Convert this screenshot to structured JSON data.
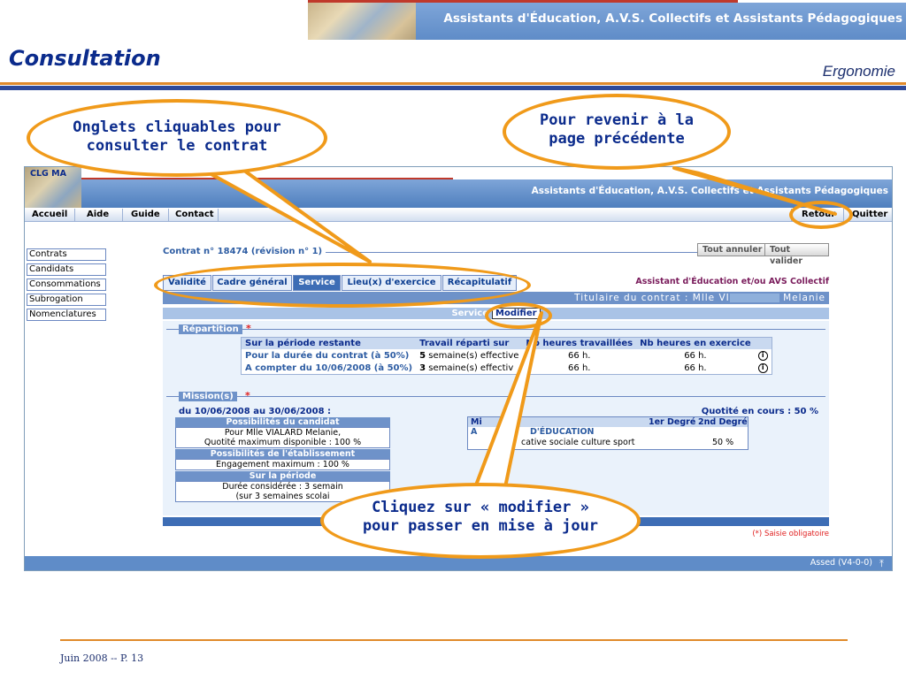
{
  "slide": {
    "banner_text": "Assistants d'Éducation, A.V.S. Collectifs et Assistants Pédagogiques",
    "title": "Consultation",
    "subtitle": "Ergonomie",
    "footer": "Juin 2008 -- P. 13"
  },
  "app": {
    "school_name": "CLG MA",
    "title": "Assistants d'Éducation, A.V.S. Collectifs et Assistants Pédagogiques",
    "menu": {
      "accueil": "Accueil",
      "aide": "Aide",
      "guide": "Guide",
      "contact": "Contact",
      "retour": "Retour",
      "quitter": "Quitter"
    },
    "sidebar": [
      "Contrats",
      "Candidats",
      "Consommations",
      "Subrogation",
      "Nomenclatures"
    ],
    "contract_title": "Contrat n° 18474 (révision n° 1)",
    "buttons": {
      "cancel_all": "Tout annuler",
      "validate_all": "Tout valider"
    },
    "tabs": [
      {
        "label": "Validité",
        "active": false
      },
      {
        "label": "Cadre général",
        "active": false
      },
      {
        "label": "Service",
        "active": true
      },
      {
        "label": "Lieu(x) d'exercice",
        "active": false
      },
      {
        "label": "Récapitulatif",
        "active": false
      }
    ],
    "role": "Assistant d'Éducation et/ou AVS Collectif",
    "holder": "Titulaire du contrat : Mlle VI",
    "holder_name": " Melanie",
    "service_label": "Service",
    "modify_button": "Modifier",
    "repartition": {
      "legend": "Répartition",
      "required_mark": "*",
      "headers": [
        "Sur la période restante",
        "Travail réparti sur",
        "Nb heures travaillées",
        "Nb heures en exercice"
      ],
      "rows": [
        {
          "period": "Pour la durée du contrat (à 50%)",
          "weeks_num": "5",
          "weeks_text": " semaine(s) effective",
          "worked": "66 h.",
          "exercise": "66 h."
        },
        {
          "period": "A compter du 10/06/2008 (à 50%)",
          "weeks_num": "3",
          "weeks_text": " semaine(s) effectiv",
          "worked": "66 h.",
          "exercise": "66 h."
        }
      ]
    },
    "mission": {
      "legend": "Mission(s)",
      "required_mark": "*",
      "period": "du 10/06/2008 au 30/06/2008 :",
      "quota": "Quotité en cours : 50 %",
      "candidate_header": "Possibilités du candidat",
      "candidate_line1": "Pour Mlle VIALARD Melanie,",
      "candidate_line2": "Quotité maximum disponible : 100 %",
      "school_header": "Possibilités de l'établissement",
      "school_line": "Engagement maximum : 100 %",
      "period_header": "Sur la période",
      "period_line1": "Durée considérée : 3 semain",
      "period_line2": "(sur 3 semaines scolai",
      "table_header_left": "Mi",
      "table_header_1": "1er Degré",
      "table_header_2": "2nd Degré",
      "table_row_title_a": "A",
      "table_row_title_b": "D'ÉDUCATION",
      "table_row_desc": "cative sociale culture sport",
      "table_row_value": "50 %"
    },
    "required_note": "(*) Saisie obligatoire",
    "version": "Assed (V4-0-0)"
  },
  "callouts": {
    "tabs": "Onglets cliquables pour consulter le contrat",
    "back": "Pour revenir à la page précédente",
    "modify": "Cliquez sur « modifier » pour passer en mise à jour"
  },
  "colors": {
    "accent_orange": "#f09a1a",
    "header_blue": "#5f8cc8",
    "title_navy": "#0b2b8c"
  }
}
